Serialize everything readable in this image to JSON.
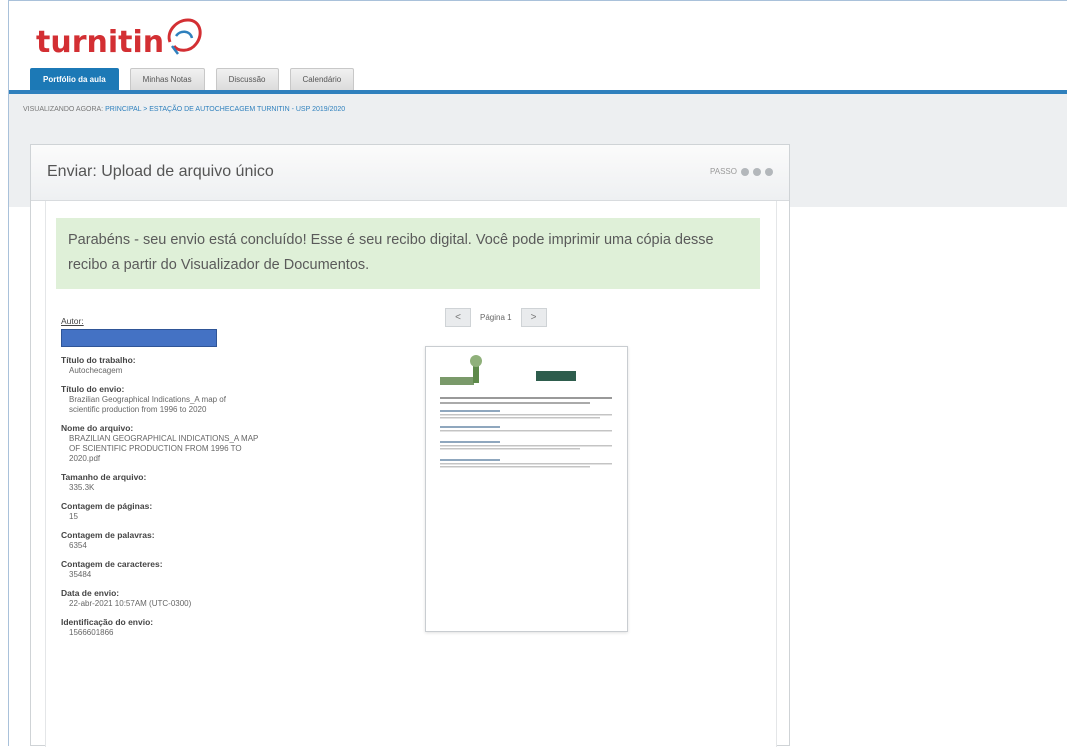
{
  "brand": {
    "name": "turnitin"
  },
  "tabs": [
    {
      "label": "Portfólio da aula",
      "active": true
    },
    {
      "label": "Minhas Notas",
      "active": false
    },
    {
      "label": "Discussão",
      "active": false
    },
    {
      "label": "Calendário",
      "active": false
    }
  ],
  "breadcrumb": {
    "prefix": "VISUALIZANDO AGORA:",
    "path": "PRINCIPAL > ESTAÇÃO DE AUTOCHECAGEM TURNITIN - USP 2019/2020"
  },
  "panel": {
    "title": "Enviar: Upload de arquivo único",
    "step_label": "PASSO",
    "step_dots": 3
  },
  "success_message": "Parabéns - seu envio está concluído! Esse é seu recibo digital. Você pode imprimir uma cópia desse recibo a partir do Visualizador de Documentos.",
  "receipt": {
    "author_label": "Autor:",
    "fields": [
      {
        "label": "Título do trabalho:",
        "value": "Autochecagem"
      },
      {
        "label": "Título do envio:",
        "value": "Brazilian Geographical Indications_A map of\nscientific production from 1996 to 2020"
      },
      {
        "label": "Nome do arquivo:",
        "value": "BRAZILIAN GEOGRAPHICAL INDICATIONS_A MAP\nOF SCIENTIFIC PRODUCTION FROM 1996 TO\n2020.pdf"
      },
      {
        "label": "Tamanho de arquivo:",
        "value": "335.3K"
      },
      {
        "label": "Contagem de páginas:",
        "value": "15"
      },
      {
        "label": "Contagem de palavras:",
        "value": "6354"
      },
      {
        "label": "Contagem de caracteres:",
        "value": "35484"
      },
      {
        "label": "Data de envio:",
        "value": "22-abr-2021 10:57AM (UTC-0300)"
      },
      {
        "label": "Identificação do envio:",
        "value": "1566601866"
      }
    ]
  },
  "viewer": {
    "prev": "<",
    "next": ">",
    "page_label": "Página 1"
  },
  "colors": {
    "brand_red": "#d32f33",
    "tab_active": "#1c79b6",
    "success_bg": "#dff0d8",
    "redaction": "#4472c4"
  }
}
